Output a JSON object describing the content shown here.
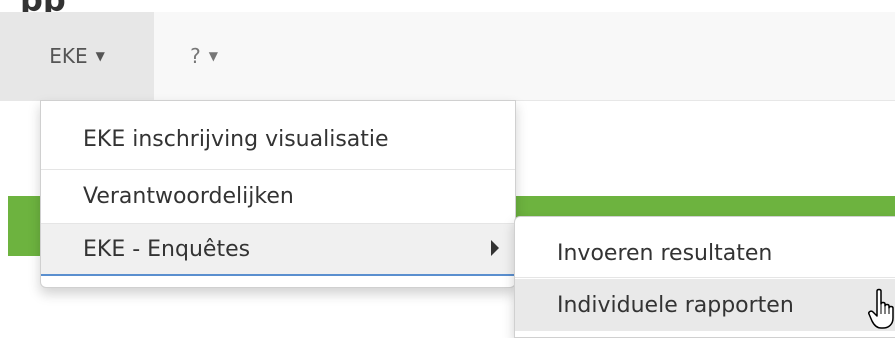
{
  "app": {
    "title_fragment": "pp"
  },
  "navbar": {
    "items": [
      {
        "label": "EKE",
        "active": true
      },
      {
        "label": "?",
        "active": false
      }
    ]
  },
  "dropdown": {
    "items": [
      {
        "label": "EKE inschrijving visualisatie"
      },
      {
        "label": "Verantwoordelijken"
      },
      {
        "label": "EKE - Enquêtes",
        "has_submenu": true
      }
    ]
  },
  "submenu": {
    "items": [
      {
        "label": "Invoeren resultaten"
      },
      {
        "label": "Individuele rapporten"
      }
    ]
  },
  "colors": {
    "navbar_bg": "#f8f8f8",
    "active_tab_bg": "#e7e7e7",
    "green_bar": "#6db33f",
    "hover_underline": "#5a8fcf"
  }
}
